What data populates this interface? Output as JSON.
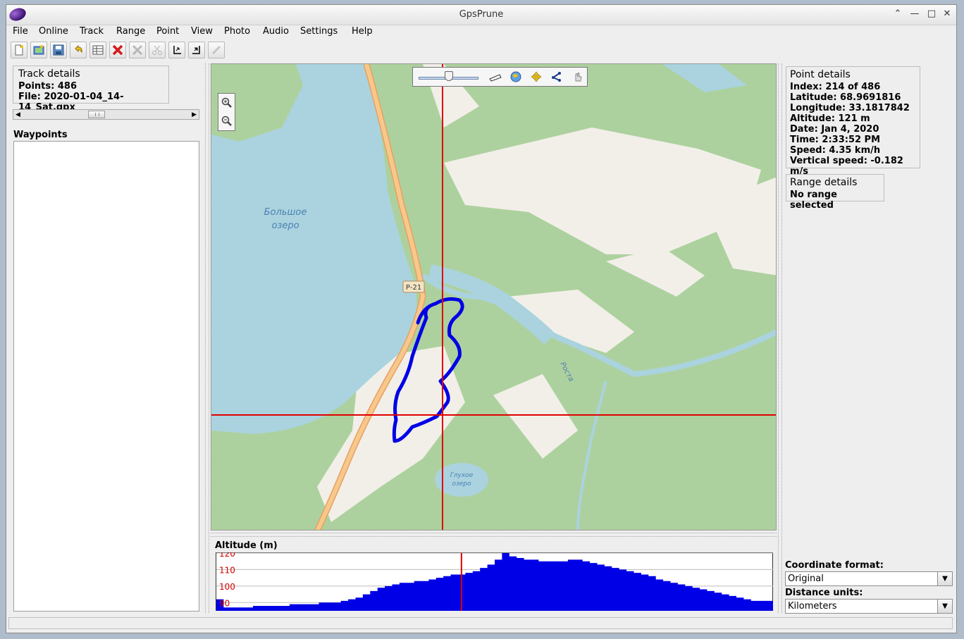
{
  "window": {
    "title": "GpsPrune"
  },
  "menu": [
    "File",
    "Online",
    "Track",
    "Range",
    "Point",
    "View",
    "Photo",
    "Audio",
    "Settings",
    "Help"
  ],
  "toolbar": {
    "icons": [
      "new-file-icon",
      "open-file-icon",
      "save-icon",
      "undo-icon",
      "edit-table-icon",
      "delete-point-icon",
      "delete-range-icon",
      "cut-icon",
      "select-start-icon",
      "select-end-icon",
      "connect-photo-icon"
    ]
  },
  "track_details": {
    "title": "Track details",
    "points": "Points: 486",
    "file": "File: 2020-01-04_14-14_Sat.gpx"
  },
  "waypoints": {
    "title": "Waypoints"
  },
  "map": {
    "labels": {
      "lake_big_1": "Большое",
      "lake_big_2": "озеро",
      "road": "Р-21",
      "river": "Роста",
      "lake_small_1": "Глухое",
      "lake_small_2": "озеро"
    },
    "colors": {
      "track": "#0000e6",
      "crosshair": "#e00000",
      "forest": "#add19e",
      "water": "#aad3df",
      "land": "#f2efe9"
    }
  },
  "point_details": {
    "title": "Point details",
    "index": "Index: 214 of 486",
    "latitude": "Latitude: 68.9691816",
    "longitude": "Longitude: 33.1817842",
    "altitude": "Altitude: 121 m",
    "date": "Date: Jan 4, 2020",
    "time": "Time: 2:33:52 PM",
    "speed": "Speed: 4.35 km/h",
    "vspeed": "Vertical speed: -0.182 m/s"
  },
  "range_details": {
    "title": "Range details",
    "value": "No range selected"
  },
  "altitude_chart": {
    "title": "Altitude (m)",
    "y_ticks": [
      "120",
      "110",
      "100",
      "90"
    ]
  },
  "chart_data": {
    "type": "area",
    "title": "Altitude (m)",
    "ylim": [
      85,
      120
    ],
    "y_ticks": [
      120,
      110,
      100,
      90
    ],
    "selected_index": 214,
    "total_points": 486,
    "profile": [
      92,
      87,
      87,
      87,
      87,
      88,
      88,
      88,
      88,
      88,
      89,
      89,
      89,
      89,
      90,
      90,
      90,
      91,
      92,
      93,
      95,
      97,
      99,
      100,
      101,
      102,
      102,
      103,
      103,
      104,
      105,
      106,
      107,
      107,
      108,
      109,
      111,
      113,
      116,
      120,
      118,
      117,
      116,
      116,
      115,
      115,
      115,
      115,
      116,
      116,
      115,
      114,
      113,
      112,
      111,
      110,
      109,
      108,
      107,
      106,
      104,
      103,
      102,
      101,
      100,
      99,
      98,
      97,
      96,
      95,
      94,
      93,
      92,
      91,
      91,
      91
    ]
  },
  "settings": {
    "coord_label": "Coordinate format:",
    "coord_value": "Original",
    "units_label": "Distance units:",
    "units_value": "Kilometers"
  }
}
